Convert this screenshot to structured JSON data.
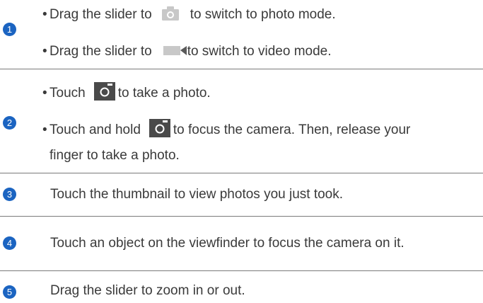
{
  "steps": [
    {
      "number": "1",
      "lines": [
        {
          "bullet": "•",
          "before": "Drag the slider to",
          "icon": "camera-mode-icon",
          "after": "to switch to photo mode."
        },
        {
          "bullet": "•",
          "before": "Drag the slider to",
          "icon": "video-mode-icon",
          "after": "to switch to video mode."
        }
      ]
    },
    {
      "number": "2",
      "lines": [
        {
          "bullet": "•",
          "before": "Touch",
          "icon": "shutter-icon",
          "after": "to take a photo."
        },
        {
          "bullet": "•",
          "before": "Touch and hold",
          "icon": "shutter-icon",
          "after": "to focus the camera. Then, release your"
        },
        {
          "continuation": "finger to take a photo."
        }
      ]
    },
    {
      "number": "3",
      "text": "Touch the thumbnail to view photos you just took."
    },
    {
      "number": "4",
      "text": "Touch an object on the viewfinder to focus the camera on it."
    },
    {
      "number": "5",
      "text": "Drag the slider to zoom in or out."
    }
  ],
  "colors": {
    "badge": "#1b64c1",
    "text": "#3a3a3a",
    "divider": "#7a7a7a",
    "icon_light": "#c8c8c8",
    "icon_dark": "#4a4a4a"
  }
}
